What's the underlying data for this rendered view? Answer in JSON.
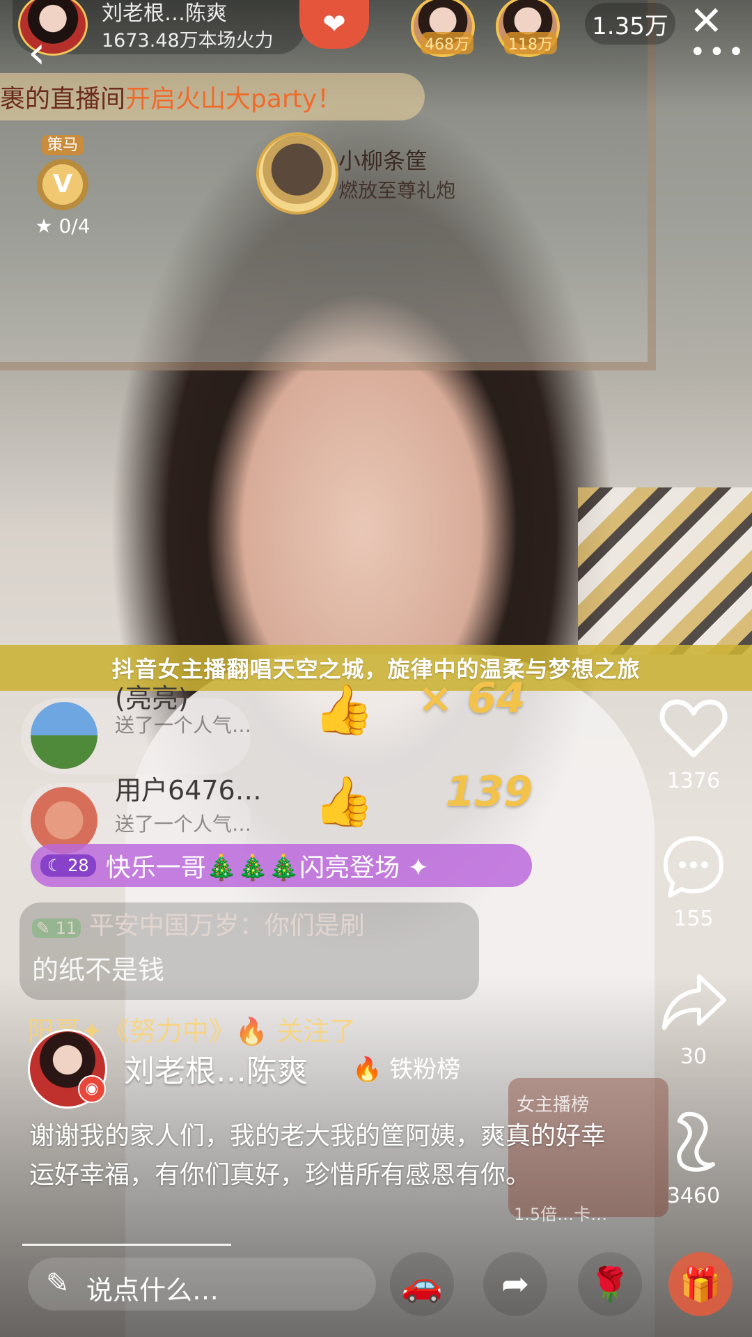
{
  "top_bar": {
    "host_name": "刘老根…陈爽",
    "host_heat": "1673.48万本场火力",
    "viewer_badges": [
      "468万",
      "118万"
    ],
    "viewer_count": "1.35万",
    "close_icon": "close-icon",
    "more_icon": "more-icon",
    "back_icon": "back-icon"
  },
  "banner": {
    "text_prefix": "裹",
    "text_mid": " 的直播间 ",
    "text_highlight": "开启火山大party！"
  },
  "vip": {
    "tag": "策马",
    "medal": "V",
    "count": "0/4"
  },
  "entrant": {
    "name": "小柳条筐",
    "action": "燃放至尊礼炮"
  },
  "title": "抖音女主播翻唱天空之城，旋律中的温柔与梦想之旅",
  "gifts": [
    {
      "user": "(亮亮)",
      "sub": "送了一个人气…",
      "count": "× 64"
    },
    {
      "user": "用户6476…",
      "sub": "送了一个人气…",
      "count": "139"
    }
  ],
  "chat": [
    {
      "level": "28",
      "text": "快乐一哥🎄🎄🎄闪亮登场 ✦"
    },
    {
      "level": "11",
      "text_line1": "平安中国万岁：你们是刷",
      "text_line2": "的纸不是钱"
    },
    {
      "text": "阳哥✦《努力中》🔥 关注了"
    }
  ],
  "rank_box": {
    "title": "女主播榜",
    "sub": "1.5倍…卡…"
  },
  "rail": {
    "likes": "1376",
    "comments": "155",
    "shares": "30",
    "music": "3460"
  },
  "author": {
    "name": "刘老根…陈爽",
    "fan_tag": "铁粉榜",
    "description": "谢谢我的家人们，我的老大我的筐阿姨，爽真的好幸运好幸福，有你们真好，珍惜所有感恩有你。"
  },
  "bottom_bar": {
    "input_placeholder": "说点什么…"
  },
  "progress": {
    "fraction": 0.3
  },
  "colors": {
    "title_bar": "#cbb234",
    "chat_purple": "#bc6adc",
    "gold": "#f2c24a"
  }
}
